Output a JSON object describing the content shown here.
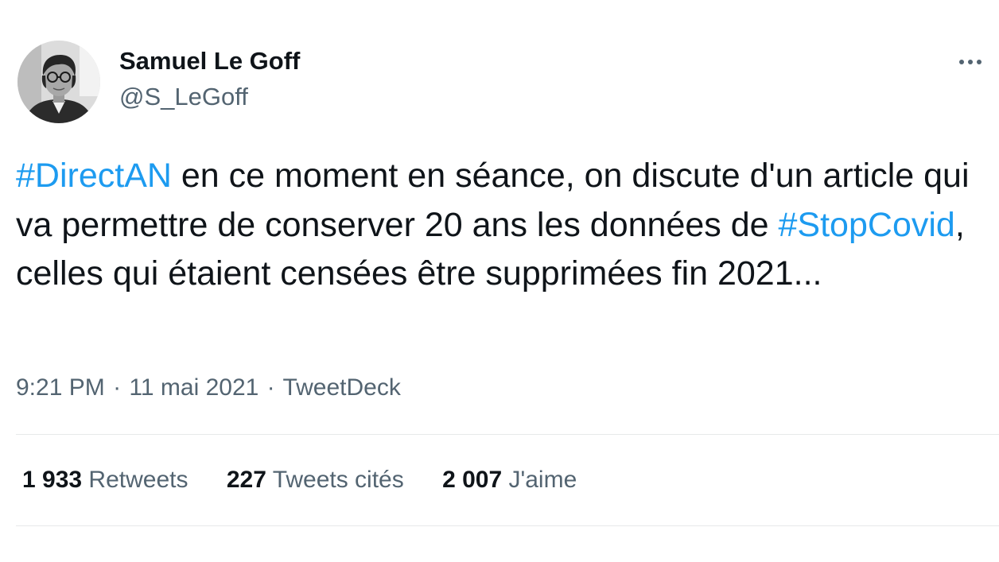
{
  "author": {
    "display_name": "Samuel Le Goff",
    "handle": "@S_LeGoff"
  },
  "tweet": {
    "segments": [
      {
        "text": "#DirectAN",
        "type": "hashtag"
      },
      {
        "text": " en ce moment en séance, on discute d'un article qui va permettre de conserver 20 ans les données de ",
        "type": "text"
      },
      {
        "text": "#StopCovid",
        "type": "hashtag"
      },
      {
        "text": ", celles qui étaient censées être supprimées fin 2021...",
        "type": "text"
      }
    ]
  },
  "meta": {
    "time": "9:21 PM",
    "separator": "·",
    "date": "11 mai 2021",
    "source": "TweetDeck"
  },
  "stats": {
    "retweets": {
      "count": "1 933",
      "label": "Retweets"
    },
    "quotes": {
      "count": "227",
      "label": "Tweets cités"
    },
    "likes": {
      "count": "2 007",
      "label": "J'aime"
    }
  },
  "icons": {
    "more": "more-dots-icon",
    "avatar": "profile-photo"
  },
  "colors": {
    "hashtag": "#1d9bf0",
    "primary_text": "#0f1419",
    "secondary_text": "#536471",
    "divider": "#e7e9ea"
  }
}
